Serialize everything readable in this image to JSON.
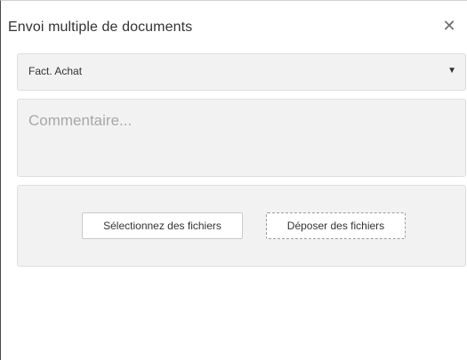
{
  "dialog": {
    "title": "Envoi multiple de documents",
    "close_icon": "close-icon",
    "close_glyph": "✕"
  },
  "document_type": {
    "selected": "Fact. Achat",
    "caret_icon": "chevron-down-icon",
    "caret_glyph": "▼"
  },
  "comment": {
    "placeholder": "Commentaire..."
  },
  "upload": {
    "select_files_label": "Sélectionnez des fichiers",
    "drop_files_label": "Déposer des fichiers"
  }
}
